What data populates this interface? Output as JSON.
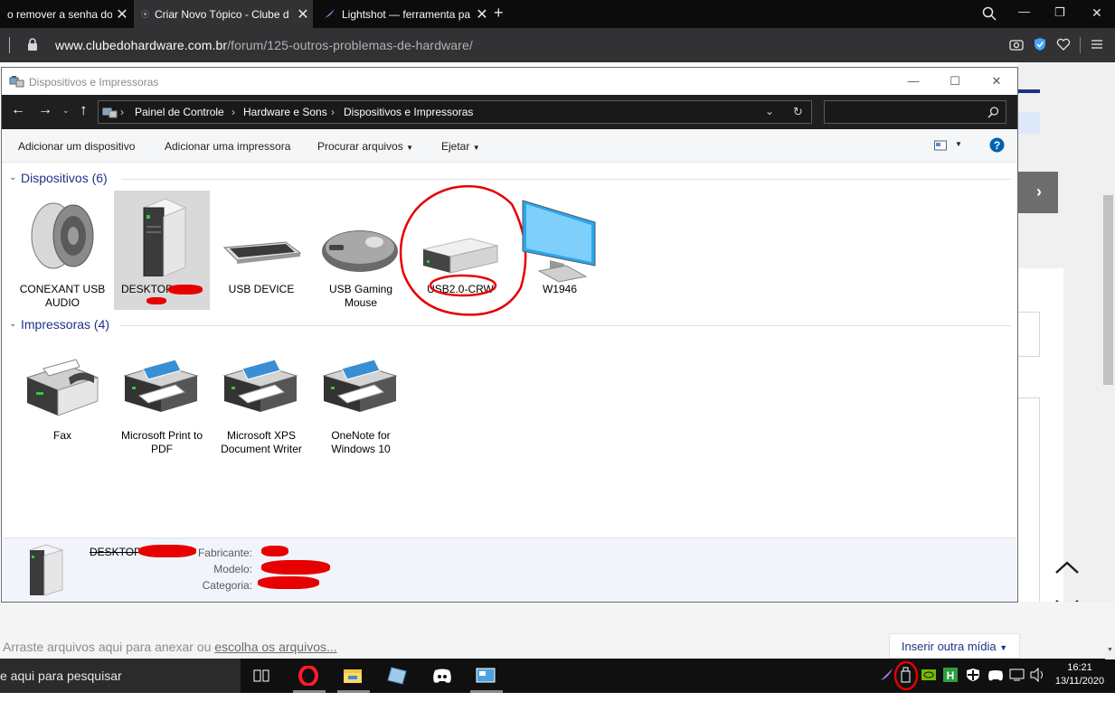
{
  "browser": {
    "tabs": [
      {
        "title": "o remover a senha do",
        "active": false
      },
      {
        "title": "Criar Novo Tópico - Clube d",
        "active": true
      },
      {
        "title": "Lightshot — ferramenta pa",
        "active": false
      }
    ],
    "new_tab": "+",
    "window_controls": {
      "minimize": "—",
      "restore": "❐",
      "close": "✕"
    },
    "url_host": "www.clubedohardware.com.br",
    "url_path": "/forum/125-outros-problemas-de-hardware/"
  },
  "explorer": {
    "title": "Dispositivos e Impressoras",
    "breadcrumb": [
      "Painel de Controle",
      "Hardware e Sons",
      "Dispositivos e Impressoras"
    ],
    "search_placeholder": "",
    "commands": {
      "add_device": "Adicionar um dispositivo",
      "add_printer": "Adicionar uma impressora",
      "browse_files": "Procurar arquivos",
      "eject": "Ejetar"
    },
    "groups": {
      "devices_heading": "Dispositivos (6)",
      "printers_heading": "Impressoras (4)"
    },
    "devices": [
      {
        "label": "CONEXANT USB AUDIO",
        "icon": "speaker-icon"
      },
      {
        "label": "DESKTOP-",
        "icon": "computer-tower-icon",
        "selected": true
      },
      {
        "label": "USB DEVICE",
        "icon": "keyboard-icon"
      },
      {
        "label": "USB Gaming Mouse",
        "icon": "mouse-icon"
      },
      {
        "label": "USB2.0-CRW",
        "icon": "external-drive-icon"
      },
      {
        "label": "W1946",
        "icon": "monitor-icon"
      }
    ],
    "printers": [
      {
        "label": "Fax",
        "icon": "fax-icon"
      },
      {
        "label": "Microsoft Print to PDF",
        "icon": "printer-icon"
      },
      {
        "label": "Microsoft XPS Document Writer",
        "icon": "printer-icon"
      },
      {
        "label": "OneNote for Windows 10",
        "icon": "printer-icon"
      }
    ],
    "details": {
      "name": "DESKTOP-",
      "manufacturer_label": "Fabricante:",
      "model_label": "Modelo:",
      "category_label": "Categoria:"
    }
  },
  "page": {
    "attach_text": "Arraste arquivos aqui para anexar ou",
    "attach_link": "escolha os arquivos...",
    "insert_media": "Inserir outra mídia"
  },
  "taskbar": {
    "search_text": "e aqui para pesquisar",
    "time": "16:21",
    "date": "13/11/2020"
  },
  "colors": {
    "annotation_red": "#e60000",
    "link_blue": "#1e3287",
    "help_blue": "#0063b1"
  }
}
